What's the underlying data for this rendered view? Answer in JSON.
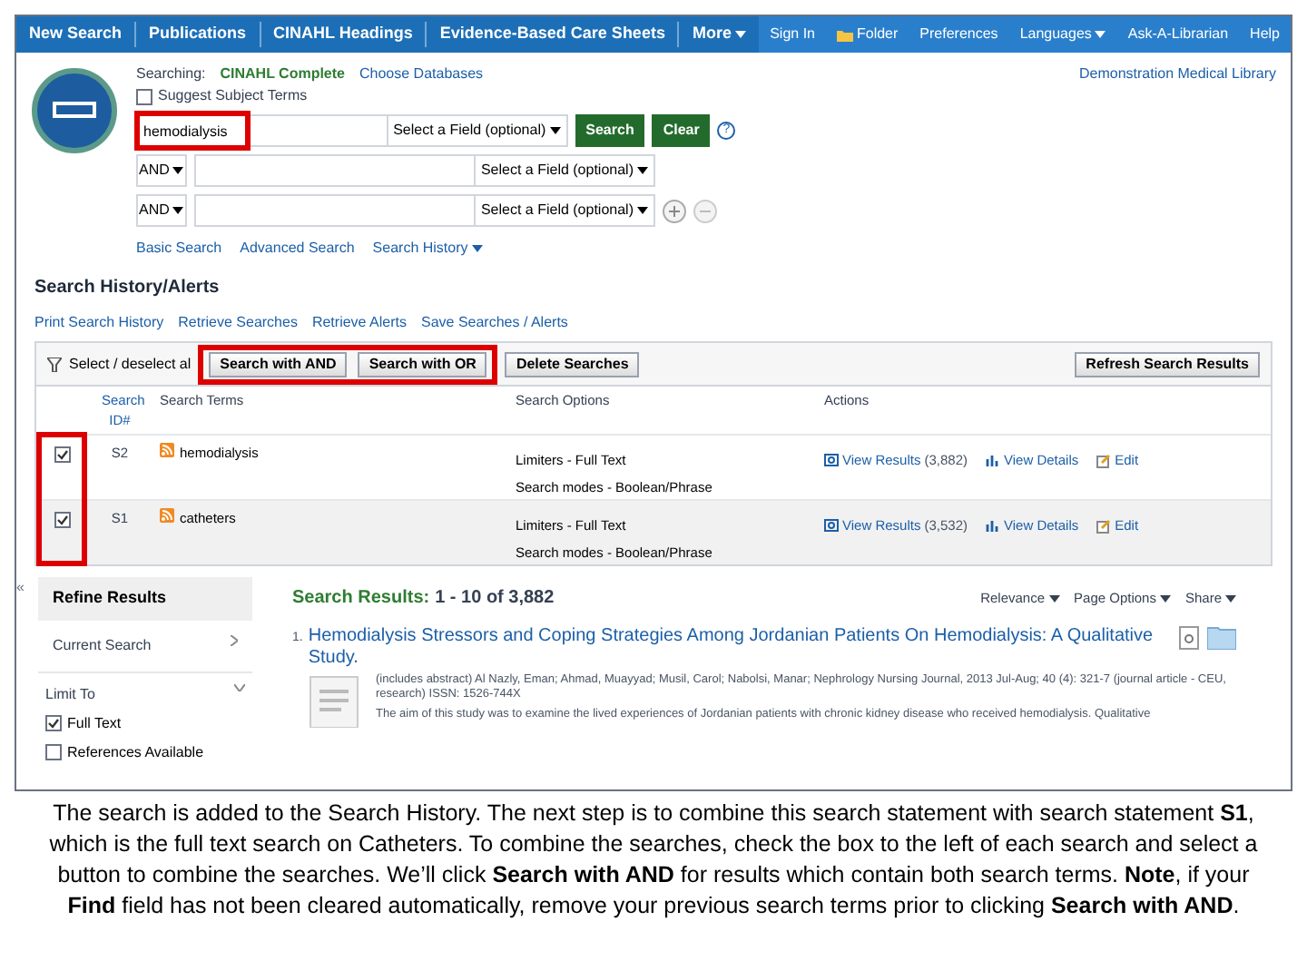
{
  "nav": {
    "left": [
      {
        "label": "New Search"
      },
      {
        "label": "Publications"
      },
      {
        "label": "CINAHL Headings"
      },
      {
        "label": "Evidence-Based Care Sheets"
      },
      {
        "label": "More",
        "caret": true
      }
    ],
    "right": [
      {
        "label": "Sign In"
      },
      {
        "label": "Folder",
        "kind": "folder"
      },
      {
        "label": "Preferences"
      },
      {
        "label": "Languages",
        "caret": true
      },
      {
        "label": "Ask-A-Librarian"
      },
      {
        "label": "Help"
      }
    ]
  },
  "search": {
    "searching_label": "Searching:",
    "database": "CINAHL Complete",
    "choose": "Choose Databases",
    "suggest": {
      "label": "Suggest Subject Terms",
      "checked": false
    },
    "library": "Demonstration Medical Library",
    "rows": [
      {
        "value": "hemodialysis",
        "field": "Select a Field (optional)"
      },
      {
        "operator": "AND",
        "value": "",
        "field": "Select a Field (optional)"
      },
      {
        "operator": "AND",
        "value": "",
        "field": "Select a Field (optional)"
      }
    ],
    "search_button": "Search",
    "clear_button": "Clear",
    "help": "?",
    "links": [
      {
        "label": "Basic Search"
      },
      {
        "label": "Advanced Search"
      },
      {
        "label": "Search History",
        "caret": true
      }
    ]
  },
  "history": {
    "title": "Search History/Alerts",
    "links": [
      "Print Search History",
      "Retrieve Searches",
      "Retrieve Alerts",
      "Save Searches / Alerts"
    ],
    "select_all": "Select / deselect al",
    "buttons": [
      "Search with AND",
      "Search with OR",
      "Delete Searches"
    ],
    "refresh": "Refresh Search Results",
    "columns": [
      "Search ID#",
      "Search Terms",
      "Search Options",
      "Actions"
    ],
    "rows": [
      {
        "checked": true,
        "id": "S2",
        "terms": "hemodialysis",
        "limiters": "Limiters - Full Text",
        "modes": "Search modes - Boolean/Phrase",
        "view": "View Results",
        "count": "(3,882)",
        "details": "View Details",
        "edit": "Edit"
      },
      {
        "checked": true,
        "id": "S1",
        "terms": "catheters",
        "limiters": "Limiters - Full Text",
        "modes": "Search modes - Boolean/Phrase",
        "view": "View Results",
        "count": "(3,532)",
        "details": "View Details",
        "edit": "Edit"
      }
    ]
  },
  "refine": {
    "collapse": "«",
    "title": "Refine Results",
    "current": "Current Search",
    "limit_to": "Limit To",
    "limits": [
      {
        "label": "Full Text",
        "checked": true
      },
      {
        "label": "References Available",
        "checked": false
      }
    ]
  },
  "results": {
    "label": "Search Results:",
    "range": "1 - 10 of 3,882",
    "menus": [
      "Relevance",
      "Page Options",
      "Share"
    ],
    "items": [
      {
        "number": "1.",
        "title": "Hemodialysis Stressors and Coping Strategies Among Jordanian Patients On Hemodialysis: A Qualitative Study.",
        "citation": "(includes abstract) Al Nazly, Eman; Ahmad, Muayyad; Musil, Carol; Nabolsi, Manar; Nephrology Nursing Journal, 2013 Jul-Aug; 40 (4): 321-7 (journal article - CEU, research) ISSN: 1526-744X",
        "abstract": "The aim of this study was to examine the lived experiences of Jordanian patients with chronic kidney disease who received hemodialysis. Qualitative"
      }
    ]
  },
  "caption": "The search is added to the Search History. The next step is to combine this search statement with search statement **S1**, which is the full text search on Catheters. To combine the searches, check the box to the left of each search and select a button to combine the searches. We’ll click **Search with AND** for results which contain both search terms. **Note**, if your **Find** field has not been cleared automatically, remove your previous search terms prior to clicking **Search with AND**."
}
